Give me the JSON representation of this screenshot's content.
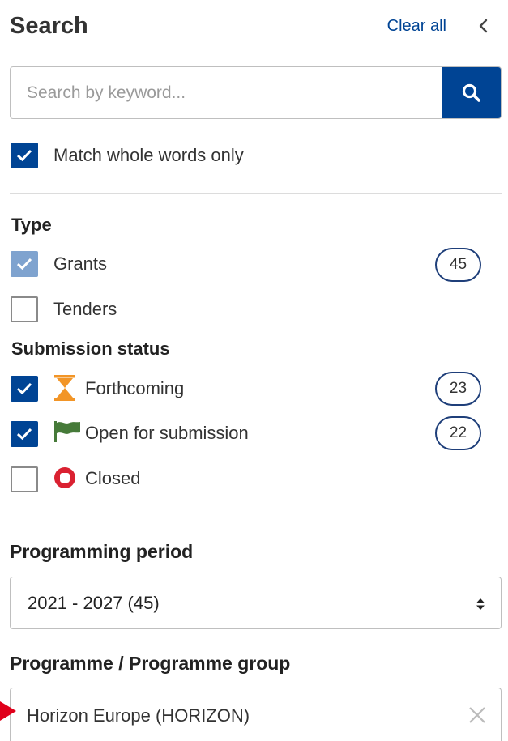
{
  "header": {
    "title": "Search",
    "clear_all": "Clear all"
  },
  "search": {
    "placeholder": "Search by keyword...",
    "value": ""
  },
  "match_whole_words": {
    "label": "Match whole words only",
    "checked": true
  },
  "type": {
    "heading": "Type",
    "options": [
      {
        "label": "Grants",
        "checked": true,
        "count": "45"
      },
      {
        "label": "Tenders",
        "checked": false
      }
    ]
  },
  "submission_status": {
    "heading": "Submission status",
    "options": [
      {
        "label": "Forthcoming",
        "checked": true,
        "count": "23",
        "icon": "hourglass-icon"
      },
      {
        "label": "Open for submission",
        "checked": true,
        "count": "22",
        "icon": "flag-icon"
      },
      {
        "label": "Closed",
        "checked": false,
        "icon": "closed-circle-icon"
      }
    ]
  },
  "programming_period": {
    "heading": "Programming period",
    "selected": "2021 - 2027 (45)"
  },
  "programme_group": {
    "heading": "Programme / Programme group",
    "selected": "Horizon Europe (HORIZON)"
  },
  "colors": {
    "primary": "#004494",
    "checkbox_light": "#7fa3cf",
    "hourglass": "#f29527",
    "flag": "#467a39",
    "closed": "#da2131",
    "pointer": "#e0001b"
  }
}
